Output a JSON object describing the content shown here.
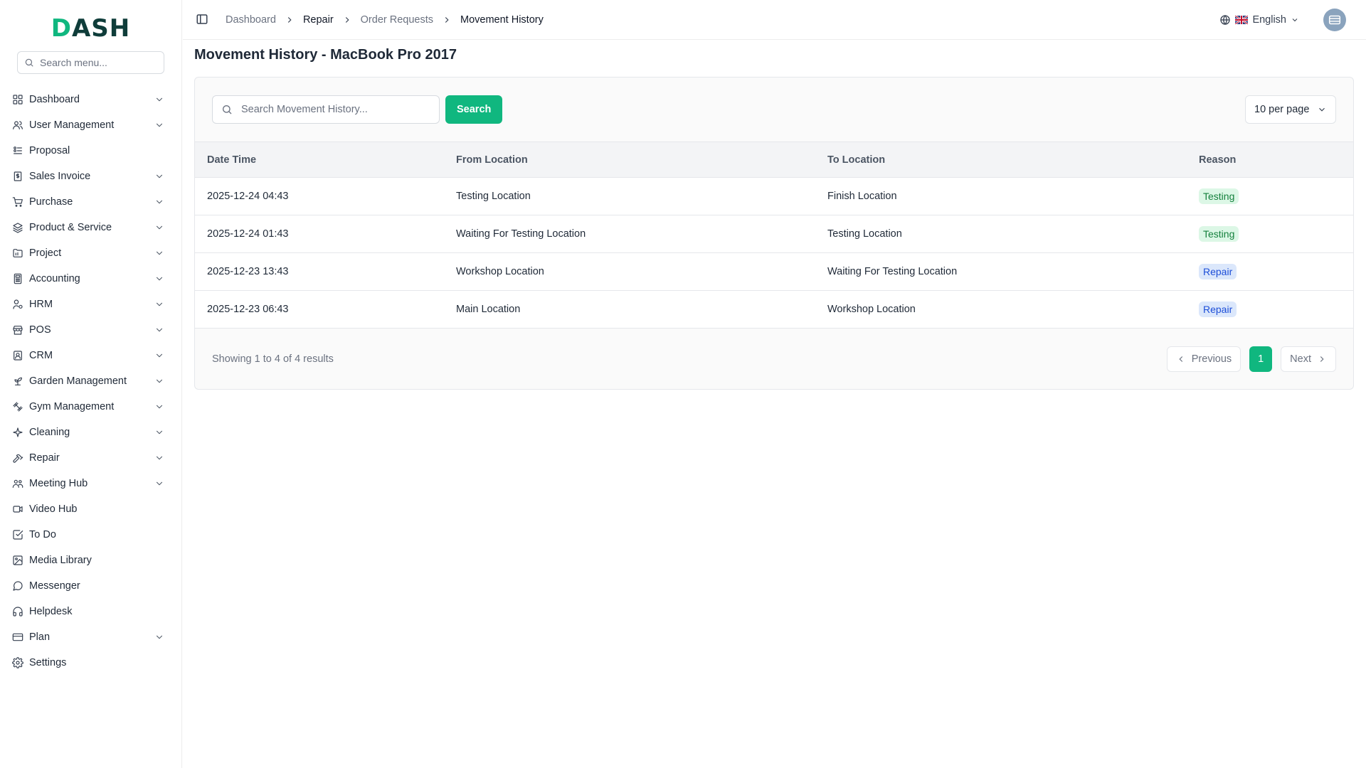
{
  "app": {
    "logo": {
      "accent": "D",
      "rest": "ASH"
    },
    "accent_color": "#10b77f"
  },
  "sidebar": {
    "search_placeholder": "Search menu...",
    "items": [
      {
        "label": "Dashboard",
        "icon": "grid-icon",
        "chevron": true
      },
      {
        "label": "User Management",
        "icon": "users-icon",
        "chevron": true
      },
      {
        "label": "Proposal",
        "icon": "proposal-icon",
        "chevron": false
      },
      {
        "label": "Sales Invoice",
        "icon": "invoice-icon",
        "chevron": true
      },
      {
        "label": "Purchase",
        "icon": "cart-icon",
        "chevron": true
      },
      {
        "label": "Product & Service",
        "icon": "layers-icon",
        "chevron": true
      },
      {
        "label": "Project",
        "icon": "folder-icon",
        "chevron": true
      },
      {
        "label": "Accounting",
        "icon": "calculator-icon",
        "chevron": true
      },
      {
        "label": "HRM",
        "icon": "user-cog-icon",
        "chevron": true
      },
      {
        "label": "POS",
        "icon": "store-icon",
        "chevron": true
      },
      {
        "label": "CRM",
        "icon": "contact-icon",
        "chevron": true
      },
      {
        "label": "Garden Management",
        "icon": "sprout-icon",
        "chevron": true
      },
      {
        "label": "Gym Management",
        "icon": "dumbbell-icon",
        "chevron": true
      },
      {
        "label": "Cleaning",
        "icon": "sparkle-icon",
        "chevron": true
      },
      {
        "label": "Repair",
        "icon": "hammer-icon",
        "chevron": true
      },
      {
        "label": "Meeting Hub",
        "icon": "meeting-icon",
        "chevron": true
      },
      {
        "label": "Video Hub",
        "icon": "video-icon",
        "chevron": false
      },
      {
        "label": "To Do",
        "icon": "checkbox-icon",
        "chevron": false
      },
      {
        "label": "Media Library",
        "icon": "image-icon",
        "chevron": false
      },
      {
        "label": "Messenger",
        "icon": "chat-icon",
        "chevron": false
      },
      {
        "label": "Helpdesk",
        "icon": "headphones-icon",
        "chevron": false
      },
      {
        "label": "Plan",
        "icon": "card-icon",
        "chevron": true
      },
      {
        "label": "Settings",
        "icon": "gear-icon",
        "chevron": false
      }
    ]
  },
  "topbar": {
    "breadcrumbs": [
      "Dashboard",
      "Repair",
      "Order Requests",
      "Movement History"
    ],
    "language": "English"
  },
  "page": {
    "title": "Movement History - MacBook Pro 2017"
  },
  "toolbar": {
    "search_placeholder": "Search Movement History...",
    "search_button": "Search",
    "per_page": "10 per page"
  },
  "table": {
    "columns": [
      "Date Time",
      "From Location",
      "To Location",
      "Reason"
    ],
    "rows": [
      {
        "datetime": "2025-12-24 04:43",
        "from": "Testing Location",
        "to": "Finish Location",
        "reason": "Testing",
        "reason_type": "testing"
      },
      {
        "datetime": "2025-12-24 01:43",
        "from": "Waiting For Testing Location",
        "to": "Testing Location",
        "reason": "Testing",
        "reason_type": "testing"
      },
      {
        "datetime": "2025-12-23 13:43",
        "from": "Workshop Location",
        "to": "Waiting For Testing Location",
        "reason": "Repair",
        "reason_type": "repair"
      },
      {
        "datetime": "2025-12-23 06:43",
        "from": "Main Location",
        "to": "Workshop Location",
        "reason": "Repair",
        "reason_type": "repair"
      }
    ]
  },
  "pagination": {
    "summary": "Showing 1 to 4 of 4 results",
    "previous": "Previous",
    "current": "1",
    "next": "Next"
  }
}
